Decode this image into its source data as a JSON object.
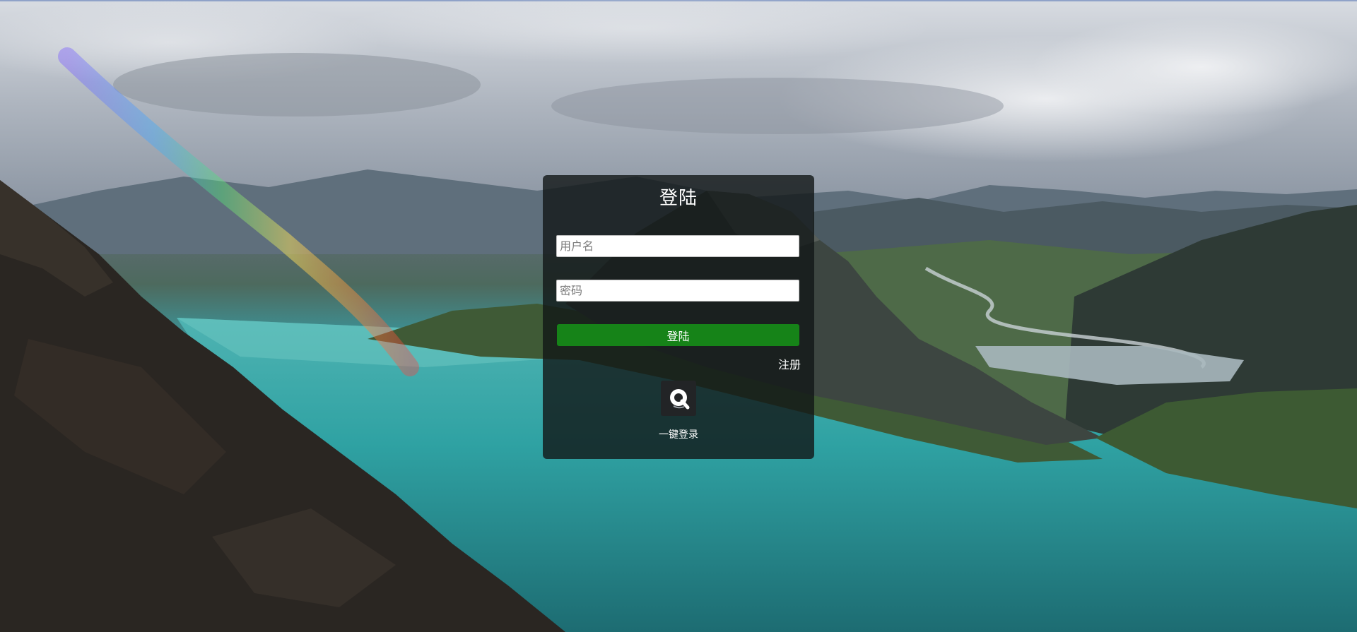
{
  "login": {
    "title": "登陆",
    "username_placeholder": "用户名",
    "password_placeholder": "密码",
    "submit_label": "登陆",
    "register_label": "注册",
    "oneclick_icon": "qq-login-icon",
    "oneclick_label": "一键登录"
  },
  "colors": {
    "submit_button": "#168318",
    "panel": "#121616"
  }
}
